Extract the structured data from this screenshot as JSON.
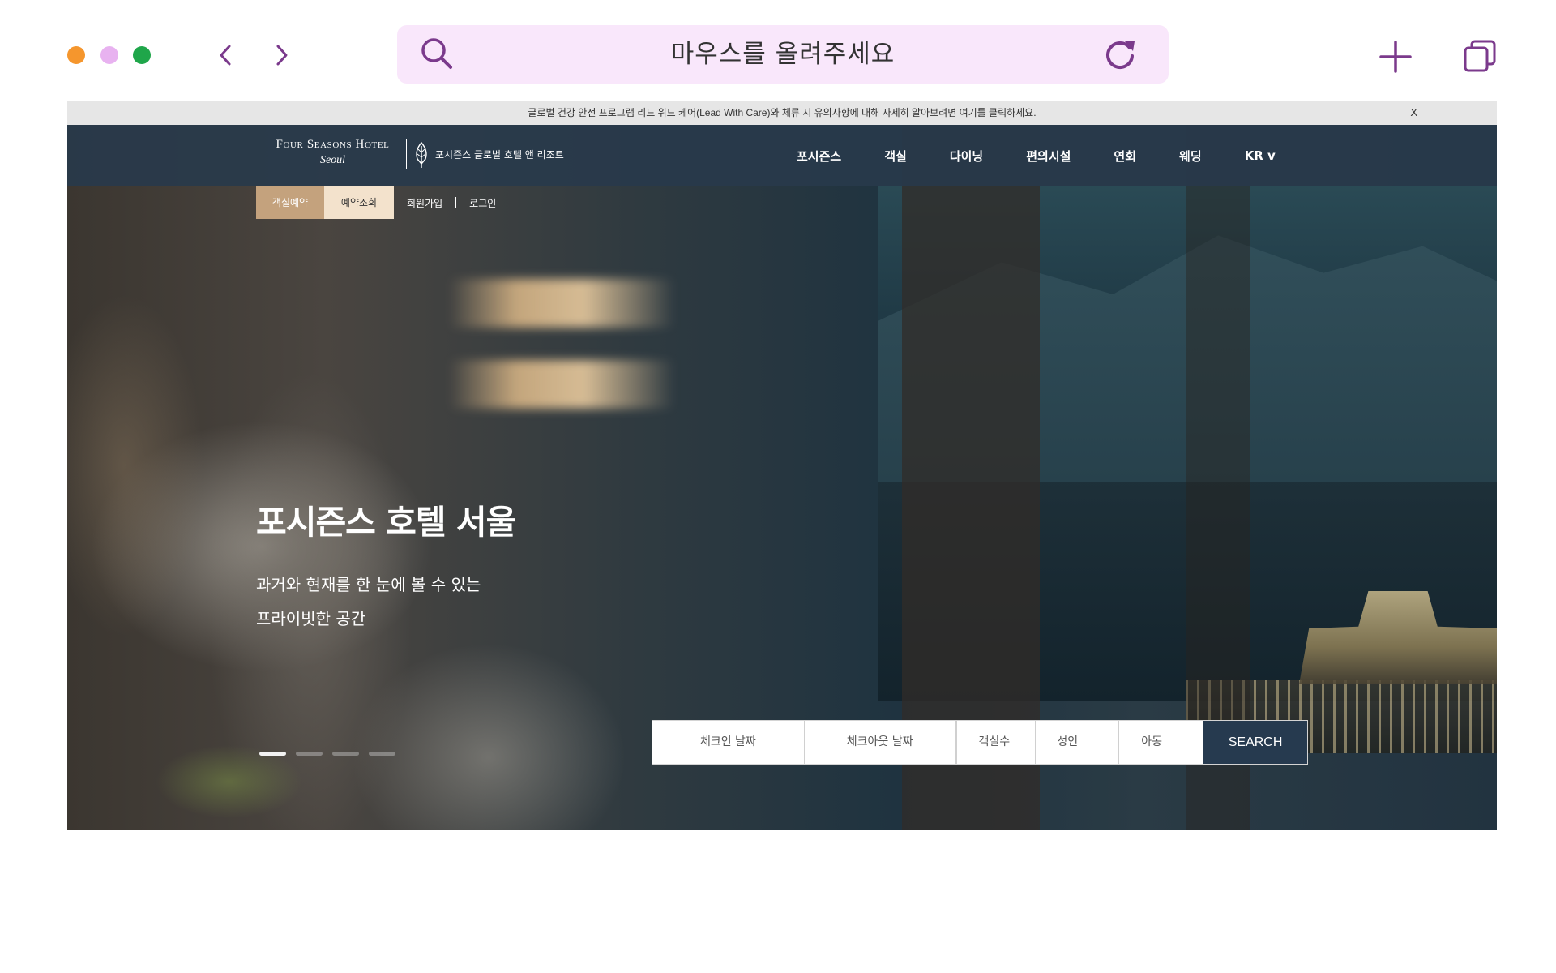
{
  "browser": {
    "address_text": "마우스를 올려주세요",
    "window_dots": [
      "#f5962d",
      "#e8b2f0",
      "#1fa64a"
    ],
    "accent": "#7b3a8c",
    "urlbar_bg": "#f9e7fb",
    "icons": [
      "back-icon",
      "forward-icon",
      "search-icon",
      "reload-icon",
      "new-tab-icon",
      "tabs-icon"
    ]
  },
  "notice": {
    "text": "글로벌 건강 안전 프로그램 리드 위드 케어(Lead With Care)와 체류 시 유의사항에 대해 자세히 알아보려면 여기를 클릭하세요.",
    "close_label": "X"
  },
  "header": {
    "logo_brand": "Four Seasons Hotel",
    "logo_city": "Seoul",
    "logo_sub": "포시즌스 글로벌 호텔 앤 리조트",
    "nav": [
      "포시즌스",
      "객실",
      "다이닝",
      "편의시설",
      "연회",
      "웨딩",
      "KR v"
    ],
    "bg": "#283a4b"
  },
  "subnav": {
    "book_label": "객실예약",
    "lookup_label": "예약조회",
    "signup_label": "회원가입",
    "login_label": "로그인",
    "book_bg": "#c4a27d",
    "lookup_bg": "#f3e2cc"
  },
  "hero": {
    "title": "포시즌스 호텔 서울",
    "desc_line1": "과거와 현재를 한 눈에 볼 수 있는",
    "desc_line2": "프라이빗한 공간",
    "slides_total": 4,
    "slide_active": 1
  },
  "booking": {
    "checkin_placeholder": "체크인 날짜",
    "checkout_placeholder": "체크아웃 날짜",
    "rooms_label": "객실수",
    "adults_label": "성인",
    "children_label": "아동",
    "search_label": "SEARCH",
    "search_bg": "#263a4f"
  }
}
